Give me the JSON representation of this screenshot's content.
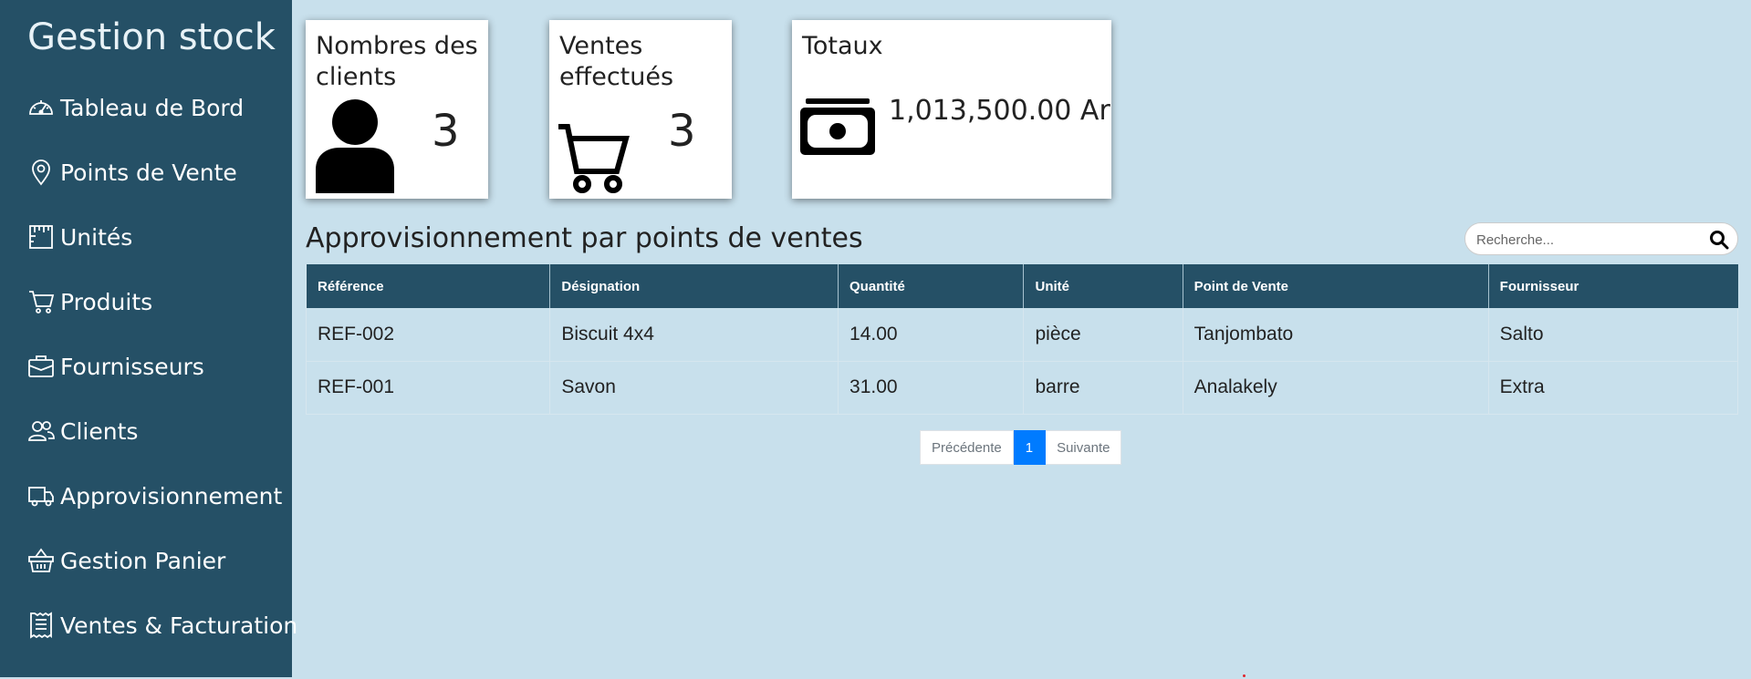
{
  "sidebar": {
    "brand": "Gestion stock",
    "items": [
      {
        "label": "Tableau de Bord",
        "icon": "speedometer-icon"
      },
      {
        "label": "Points de Vente",
        "icon": "map-pin-icon"
      },
      {
        "label": "Unités",
        "icon": "ruler-icon"
      },
      {
        "label": "Produits",
        "icon": "cart-icon"
      },
      {
        "label": "Fournisseurs",
        "icon": "briefcase-icon"
      },
      {
        "label": "Clients",
        "icon": "people-icon"
      },
      {
        "label": "Approvisionnement",
        "icon": "truck-icon"
      },
      {
        "label": "Gestion Panier",
        "icon": "basket-icon"
      },
      {
        "label": "Ventes & Facturation",
        "icon": "receipt-icon"
      }
    ]
  },
  "cards": {
    "clients": {
      "title": "Nombres des clients",
      "value": "3",
      "icon": "person-icon"
    },
    "ventes": {
      "title": "Ventes effectués",
      "value": "3",
      "icon": "cart-icon"
    },
    "totaux": {
      "title": "Totaux",
      "value": "1,013,500.00 Ar",
      "icon": "cash-icon"
    }
  },
  "section": {
    "title": "Approvisionnement par points de ventes"
  },
  "search": {
    "placeholder": "Recherche...",
    "value": ""
  },
  "table": {
    "headers": [
      "Référence",
      "Désignation",
      "Quantité",
      "Unité",
      "Point de Vente",
      "Fournisseur"
    ],
    "rows": [
      [
        "REF-002",
        "Biscuit 4x4",
        "14.00",
        "pièce",
        "Tanjombato",
        "Salto"
      ],
      [
        "REF-001",
        "Savon",
        "31.00",
        "barre",
        "Analakely",
        "Extra"
      ]
    ]
  },
  "pagination": {
    "previous": "Précédente",
    "current": "1",
    "next": "Suivante"
  },
  "colors": {
    "sidebar": "#255066",
    "background": "#c8e0ec",
    "accent": "#007bff"
  }
}
